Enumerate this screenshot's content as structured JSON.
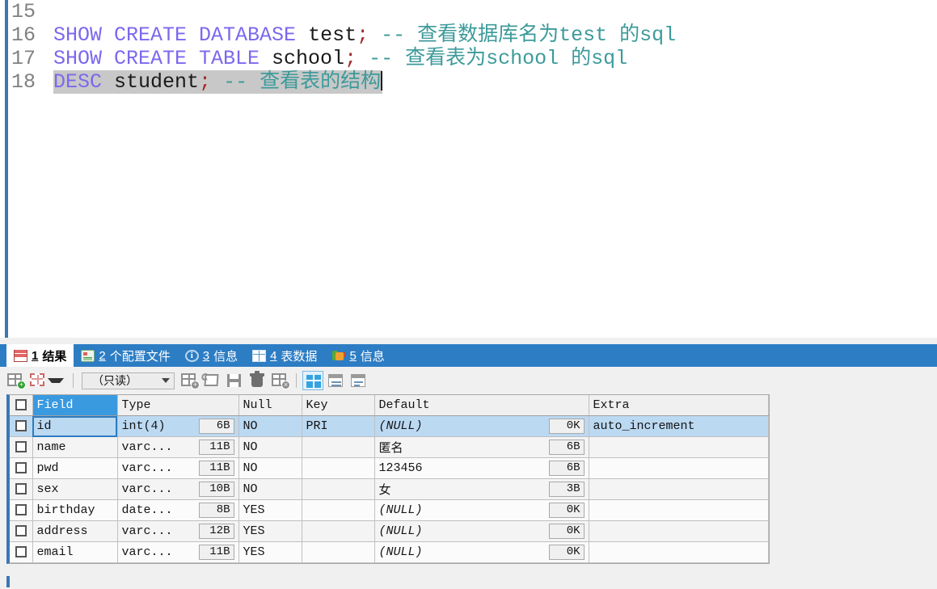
{
  "editor": {
    "lines": [
      {
        "number": "15",
        "selected": false,
        "tokens": []
      },
      {
        "number": "16",
        "selected": false,
        "tokens": [
          {
            "t": "SHOW CREATE DATABASE ",
            "c": "kw"
          },
          {
            "t": "test",
            "c": "id"
          },
          {
            "t": ";",
            "c": "semi"
          },
          {
            "t": " -- 查看数据库名为test 的sql",
            "c": "cmt"
          }
        ]
      },
      {
        "number": "17",
        "selected": false,
        "tokens": [
          {
            "t": "SHOW CREATE TABLE ",
            "c": "kw"
          },
          {
            "t": "school",
            "c": "id"
          },
          {
            "t": ";",
            "c": "semi"
          },
          {
            "t": " -- 查看表为school 的sql",
            "c": "cmt"
          }
        ]
      },
      {
        "number": "18",
        "selected": true,
        "tokens": [
          {
            "t": "DESC ",
            "c": "kw"
          },
          {
            "t": "student",
            "c": "id"
          },
          {
            "t": ";",
            "c": "semi"
          },
          {
            "t": " -- 查看表的结构",
            "c": "cmt"
          }
        ]
      }
    ]
  },
  "tabs": [
    {
      "num": "1",
      "label": "结果",
      "icon": "results-grid-icon",
      "active": true
    },
    {
      "num": "2",
      "label": "个配置文件",
      "icon": "profile-icon",
      "active": false
    },
    {
      "num": "3",
      "label": "信息",
      "icon": "info-circle-icon",
      "active": false
    },
    {
      "num": "4",
      "label": "表数据",
      "icon": "table-grid-icon",
      "active": false
    },
    {
      "num": "5",
      "label": "信息",
      "icon": "status-blobs-icon",
      "active": false
    }
  ],
  "toolbar": {
    "mode_value": "（只读）",
    "buttons": [
      {
        "name": "add-record-button",
        "icon": "grid-plus-green-icon"
      },
      {
        "name": "grid-options-button",
        "icon": "grid-dashed-red-icon",
        "has_caret": true
      },
      {
        "name": "insert-record-button",
        "icon": "grid-plus-gray-icon"
      },
      {
        "name": "refresh-button",
        "icon": "refresh-icon"
      },
      {
        "name": "save-button",
        "icon": "floppy-save-icon"
      },
      {
        "name": "delete-record-button",
        "icon": "trash-icon"
      },
      {
        "name": "cancel-changes-button",
        "icon": "grid-cancel-icon"
      },
      {
        "name": "grid-view-button",
        "icon": "grid-view-icon",
        "selected": true
      },
      {
        "name": "form-view-button",
        "icon": "form-view-icon"
      },
      {
        "name": "text-view-button",
        "icon": "text-view-icon"
      }
    ]
  },
  "grid": {
    "columns": [
      "Field",
      "Type",
      "Null",
      "Key",
      "Default",
      "Extra"
    ],
    "highlighted_column": "Field",
    "rows": [
      {
        "field": "id",
        "type": "int(4)",
        "type_size": "6B",
        "null": "NO",
        "key": "PRI",
        "default": "(NULL)",
        "default_is_null": true,
        "default_size": "0K",
        "extra": "auto_increment",
        "selected": true
      },
      {
        "field": "name",
        "type": "varc...",
        "type_size": "11B",
        "null": "NO",
        "key": "",
        "default": "匿名",
        "default_is_null": false,
        "default_size": "6B",
        "extra": "",
        "selected": false
      },
      {
        "field": "pwd",
        "type": "varc...",
        "type_size": "11B",
        "null": "NO",
        "key": "",
        "default": "123456",
        "default_is_null": false,
        "default_size": "6B",
        "extra": "",
        "selected": false
      },
      {
        "field": "sex",
        "type": "varc...",
        "type_size": "10B",
        "null": "NO",
        "key": "",
        "default": "女",
        "default_is_null": false,
        "default_size": "3B",
        "extra": "",
        "selected": false
      },
      {
        "field": "birthday",
        "type": "date...",
        "type_size": "8B",
        "null": "YES",
        "key": "",
        "default": "(NULL)",
        "default_is_null": true,
        "default_size": "0K",
        "extra": "",
        "selected": false
      },
      {
        "field": "address",
        "type": "varc...",
        "type_size": "12B",
        "null": "YES",
        "key": "",
        "default": "(NULL)",
        "default_is_null": true,
        "default_size": "0K",
        "extra": "",
        "selected": false
      },
      {
        "field": "email",
        "type": "varc...",
        "type_size": "11B",
        "null": "YES",
        "key": "",
        "default": "(NULL)",
        "default_is_null": true,
        "default_size": "0K",
        "extra": "",
        "selected": false
      }
    ]
  },
  "colors": {
    "accent_blue": "#2d7dc4",
    "selection_blue": "#bcd9f2",
    "header_highlight": "#3a9ae0",
    "keyword": "#7b68ee",
    "comment": "#3d9a9a",
    "semicolon": "#a52a2a"
  }
}
